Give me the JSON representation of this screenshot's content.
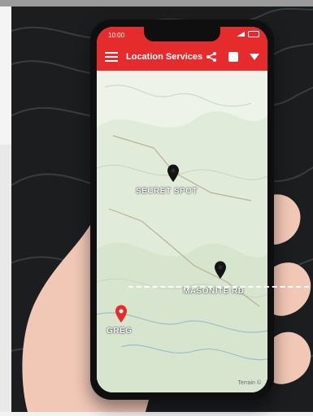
{
  "status": {
    "time": "10:00"
  },
  "app": {
    "title": "Location Services"
  },
  "markers": [
    {
      "label": "SECRET SPOT",
      "color": "#141414"
    },
    {
      "label": "MASONITE RD",
      "color": "#141414"
    },
    {
      "label": "GREG",
      "color": "#e52b2b"
    }
  ],
  "map": {
    "credit": "Terrain ©"
  },
  "icons": {
    "menu": "menu-icon",
    "share": "share-icon",
    "save": "save-icon",
    "filter": "filter-icon"
  },
  "colors": {
    "accent": "#e52b2b",
    "background": "#1b1d1f"
  }
}
